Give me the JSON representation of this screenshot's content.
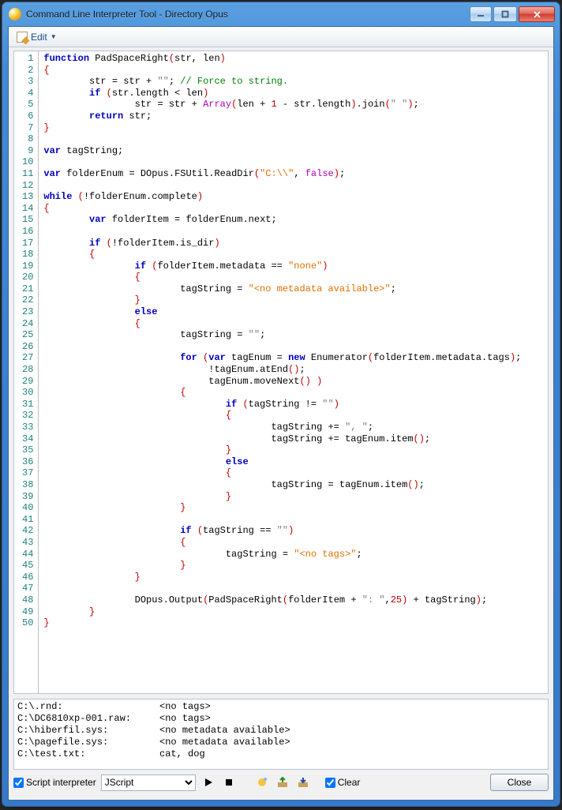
{
  "window": {
    "title": "Command Line Interpreter Tool - Directory Opus"
  },
  "toolbar": {
    "edit_label": "Edit"
  },
  "code": {
    "line_count": 50,
    "tokens": [
      [
        {
          "t": "function",
          "c": "kw"
        },
        {
          "t": " PadSpaceRight"
        },
        {
          "t": "(",
          "c": "brk"
        },
        {
          "t": "str"
        },
        {
          "t": ",",
          "c": "op"
        },
        {
          "t": " len"
        },
        {
          "t": ")",
          "c": "brk"
        }
      ],
      [
        {
          "t": "{",
          "c": "brk"
        }
      ],
      [
        {
          "t": "        str "
        },
        {
          "t": "=",
          "c": "op"
        },
        {
          "t": " str "
        },
        {
          "t": "+",
          "c": "op"
        },
        {
          "t": " "
        },
        {
          "t": "\"\"",
          "c": "str"
        },
        {
          "t": ";",
          "c": "op"
        },
        {
          "t": " "
        },
        {
          "t": "// Force to string.",
          "c": "cmt"
        }
      ],
      [
        {
          "t": "        "
        },
        {
          "t": "if",
          "c": "kw"
        },
        {
          "t": " "
        },
        {
          "t": "(",
          "c": "brk"
        },
        {
          "t": "str"
        },
        {
          "t": ".",
          "c": "op"
        },
        {
          "t": "length "
        },
        {
          "t": "<",
          "c": "op"
        },
        {
          "t": " len"
        },
        {
          "t": ")",
          "c": "brk"
        }
      ],
      [
        {
          "t": "                str "
        },
        {
          "t": "=",
          "c": "op"
        },
        {
          "t": " str "
        },
        {
          "t": "+",
          "c": "op"
        },
        {
          "t": " "
        },
        {
          "t": "Array",
          "c": "lit"
        },
        {
          "t": "(",
          "c": "brk"
        },
        {
          "t": "len "
        },
        {
          "t": "+",
          "c": "op"
        },
        {
          "t": " "
        },
        {
          "t": "1",
          "c": "num"
        },
        {
          "t": " "
        },
        {
          "t": "-",
          "c": "op"
        },
        {
          "t": " str"
        },
        {
          "t": ".",
          "c": "op"
        },
        {
          "t": "length"
        },
        {
          "t": ")",
          "c": "brk"
        },
        {
          "t": ".",
          "c": "op"
        },
        {
          "t": "join"
        },
        {
          "t": "(",
          "c": "brk"
        },
        {
          "t": "\" \"",
          "c": "str"
        },
        {
          "t": ")",
          "c": "brk"
        },
        {
          "t": ";",
          "c": "op"
        }
      ],
      [
        {
          "t": "        "
        },
        {
          "t": "return",
          "c": "kw"
        },
        {
          "t": " str"
        },
        {
          "t": ";",
          "c": "op"
        }
      ],
      [
        {
          "t": "}",
          "c": "brk"
        }
      ],
      [],
      [
        {
          "t": "var",
          "c": "kw"
        },
        {
          "t": " tagString"
        },
        {
          "t": ";",
          "c": "op"
        }
      ],
      [],
      [
        {
          "t": "var",
          "c": "kw"
        },
        {
          "t": " folderEnum "
        },
        {
          "t": "=",
          "c": "op"
        },
        {
          "t": " DOpus"
        },
        {
          "t": ".",
          "c": "op"
        },
        {
          "t": "FSUtil"
        },
        {
          "t": ".",
          "c": "op"
        },
        {
          "t": "ReadDir"
        },
        {
          "t": "(",
          "c": "brk"
        },
        {
          "t": "\"C:\\\\\"",
          "c": "str-orange"
        },
        {
          "t": ",",
          "c": "op"
        },
        {
          "t": " "
        },
        {
          "t": "false",
          "c": "lit"
        },
        {
          "t": ")",
          "c": "brk"
        },
        {
          "t": ";",
          "c": "op"
        }
      ],
      [],
      [
        {
          "t": "while",
          "c": "kw"
        },
        {
          "t": " "
        },
        {
          "t": "(",
          "c": "brk"
        },
        {
          "t": "!",
          "c": "op"
        },
        {
          "t": "folderEnum"
        },
        {
          "t": ".",
          "c": "op"
        },
        {
          "t": "complete"
        },
        {
          "t": ")",
          "c": "brk"
        }
      ],
      [
        {
          "t": "{",
          "c": "brk"
        }
      ],
      [
        {
          "t": "        "
        },
        {
          "t": "var",
          "c": "kw"
        },
        {
          "t": " folderItem "
        },
        {
          "t": "=",
          "c": "op"
        },
        {
          "t": " folderEnum"
        },
        {
          "t": ".",
          "c": "op"
        },
        {
          "t": "next"
        },
        {
          "t": ";",
          "c": "op"
        }
      ],
      [],
      [
        {
          "t": "        "
        },
        {
          "t": "if",
          "c": "kw"
        },
        {
          "t": " "
        },
        {
          "t": "(",
          "c": "brk"
        },
        {
          "t": "!",
          "c": "op"
        },
        {
          "t": "folderItem"
        },
        {
          "t": ".",
          "c": "op"
        },
        {
          "t": "is_dir"
        },
        {
          "t": ")",
          "c": "brk"
        }
      ],
      [
        {
          "t": "        "
        },
        {
          "t": "{",
          "c": "brk"
        }
      ],
      [
        {
          "t": "                "
        },
        {
          "t": "if",
          "c": "kw"
        },
        {
          "t": " "
        },
        {
          "t": "(",
          "c": "brk"
        },
        {
          "t": "folderItem"
        },
        {
          "t": ".",
          "c": "op"
        },
        {
          "t": "metadata "
        },
        {
          "t": "==",
          "c": "op"
        },
        {
          "t": " "
        },
        {
          "t": "\"none\"",
          "c": "str-orange"
        },
        {
          "t": ")",
          "c": "brk"
        }
      ],
      [
        {
          "t": "                "
        },
        {
          "t": "{",
          "c": "brk"
        }
      ],
      [
        {
          "t": "                        tagString "
        },
        {
          "t": "=",
          "c": "op"
        },
        {
          "t": " "
        },
        {
          "t": "\"<no metadata available>\"",
          "c": "str-orange"
        },
        {
          "t": ";",
          "c": "op"
        }
      ],
      [
        {
          "t": "                "
        },
        {
          "t": "}",
          "c": "brk"
        }
      ],
      [
        {
          "t": "                "
        },
        {
          "t": "else",
          "c": "kw"
        }
      ],
      [
        {
          "t": "                "
        },
        {
          "t": "{",
          "c": "brk"
        }
      ],
      [
        {
          "t": "                        tagString "
        },
        {
          "t": "=",
          "c": "op"
        },
        {
          "t": " "
        },
        {
          "t": "\"\"",
          "c": "str"
        },
        {
          "t": ";",
          "c": "op"
        }
      ],
      [],
      [
        {
          "t": "                        "
        },
        {
          "t": "for",
          "c": "kw"
        },
        {
          "t": " "
        },
        {
          "t": "(",
          "c": "brk"
        },
        {
          "t": "var",
          "c": "kw"
        },
        {
          "t": " tagEnum "
        },
        {
          "t": "=",
          "c": "op"
        },
        {
          "t": " "
        },
        {
          "t": "new",
          "c": "kw"
        },
        {
          "t": " Enumerator"
        },
        {
          "t": "(",
          "c": "brk"
        },
        {
          "t": "folderItem"
        },
        {
          "t": ".",
          "c": "op"
        },
        {
          "t": "metadata"
        },
        {
          "t": ".",
          "c": "op"
        },
        {
          "t": "tags"
        },
        {
          "t": ")",
          "c": "brk"
        },
        {
          "t": ";",
          "c": "op"
        }
      ],
      [
        {
          "t": "                             "
        },
        {
          "t": "!",
          "c": "op"
        },
        {
          "t": "tagEnum"
        },
        {
          "t": ".",
          "c": "op"
        },
        {
          "t": "atEnd"
        },
        {
          "t": "()",
          "c": "brk"
        },
        {
          "t": ";",
          "c": "op"
        }
      ],
      [
        {
          "t": "                             tagEnum"
        },
        {
          "t": ".",
          "c": "op"
        },
        {
          "t": "moveNext"
        },
        {
          "t": "()",
          "c": "brk"
        },
        {
          "t": " "
        },
        {
          "t": ")",
          "c": "brk"
        }
      ],
      [
        {
          "t": "                        "
        },
        {
          "t": "{",
          "c": "brk"
        }
      ],
      [
        {
          "t": "                                "
        },
        {
          "t": "if",
          "c": "kw"
        },
        {
          "t": " "
        },
        {
          "t": "(",
          "c": "brk"
        },
        {
          "t": "tagString "
        },
        {
          "t": "!=",
          "c": "op"
        },
        {
          "t": " "
        },
        {
          "t": "\"\"",
          "c": "str"
        },
        {
          "t": ")",
          "c": "brk"
        }
      ],
      [
        {
          "t": "                                "
        },
        {
          "t": "{",
          "c": "brk"
        }
      ],
      [
        {
          "t": "                                        tagString "
        },
        {
          "t": "+=",
          "c": "op"
        },
        {
          "t": " "
        },
        {
          "t": "\", \"",
          "c": "str"
        },
        {
          "t": ";",
          "c": "op"
        }
      ],
      [
        {
          "t": "                                        tagString "
        },
        {
          "t": "+=",
          "c": "op"
        },
        {
          "t": " tagEnum"
        },
        {
          "t": ".",
          "c": "op"
        },
        {
          "t": "item"
        },
        {
          "t": "()",
          "c": "brk"
        },
        {
          "t": ";",
          "c": "op"
        }
      ],
      [
        {
          "t": "                                "
        },
        {
          "t": "}",
          "c": "brk"
        }
      ],
      [
        {
          "t": "                                "
        },
        {
          "t": "else",
          "c": "kw"
        }
      ],
      [
        {
          "t": "                                "
        },
        {
          "t": "{",
          "c": "brk"
        }
      ],
      [
        {
          "t": "                                        tagString "
        },
        {
          "t": "=",
          "c": "op"
        },
        {
          "t": " tagEnum"
        },
        {
          "t": ".",
          "c": "op"
        },
        {
          "t": "item"
        },
        {
          "t": "()",
          "c": "brk"
        },
        {
          "t": ";",
          "c": "op"
        }
      ],
      [
        {
          "t": "                                "
        },
        {
          "t": "}",
          "c": "brk"
        }
      ],
      [
        {
          "t": "                        "
        },
        {
          "t": "}",
          "c": "brk"
        }
      ],
      [],
      [
        {
          "t": "                        "
        },
        {
          "t": "if",
          "c": "kw"
        },
        {
          "t": " "
        },
        {
          "t": "(",
          "c": "brk"
        },
        {
          "t": "tagString "
        },
        {
          "t": "==",
          "c": "op"
        },
        {
          "t": " "
        },
        {
          "t": "\"\"",
          "c": "str"
        },
        {
          "t": ")",
          "c": "brk"
        }
      ],
      [
        {
          "t": "                        "
        },
        {
          "t": "{",
          "c": "brk"
        }
      ],
      [
        {
          "t": "                                tagString "
        },
        {
          "t": "=",
          "c": "op"
        },
        {
          "t": " "
        },
        {
          "t": "\"<no tags>\"",
          "c": "str-orange"
        },
        {
          "t": ";",
          "c": "op"
        }
      ],
      [
        {
          "t": "                        "
        },
        {
          "t": "}",
          "c": "brk"
        }
      ],
      [
        {
          "t": "                "
        },
        {
          "t": "}",
          "c": "brk"
        }
      ],
      [],
      [
        {
          "t": "                DOpus"
        },
        {
          "t": ".",
          "c": "op"
        },
        {
          "t": "Output"
        },
        {
          "t": "(",
          "c": "brk"
        },
        {
          "t": "PadSpaceRight"
        },
        {
          "t": "(",
          "c": "brk"
        },
        {
          "t": "folderItem "
        },
        {
          "t": "+",
          "c": "op"
        },
        {
          "t": " "
        },
        {
          "t": "\": \"",
          "c": "str"
        },
        {
          "t": ",",
          "c": "op"
        },
        {
          "t": "25",
          "c": "num"
        },
        {
          "t": ")",
          "c": "brk"
        },
        {
          "t": " "
        },
        {
          "t": "+",
          "c": "op"
        },
        {
          "t": " tagString"
        },
        {
          "t": ")",
          "c": "brk"
        },
        {
          "t": ";",
          "c": "op"
        }
      ],
      [
        {
          "t": "        "
        },
        {
          "t": "}",
          "c": "brk"
        }
      ],
      [
        {
          "t": "}",
          "c": "brk"
        }
      ]
    ]
  },
  "output": {
    "lines": [
      "C:\\.rnd:                 <no tags>",
      "C:\\DC6810xp-001.raw:     <no tags>",
      "C:\\hiberfil.sys:         <no metadata available>",
      "C:\\pagefile.sys:         <no metadata available>",
      "C:\\test.txt:             cat, dog"
    ]
  },
  "bottombar": {
    "script_interpreter_label": "Script interpreter",
    "script_interpreter_checked": true,
    "language_selected": "JScript",
    "clear_label": "Clear",
    "clear_checked": true,
    "close_label": "Close"
  }
}
